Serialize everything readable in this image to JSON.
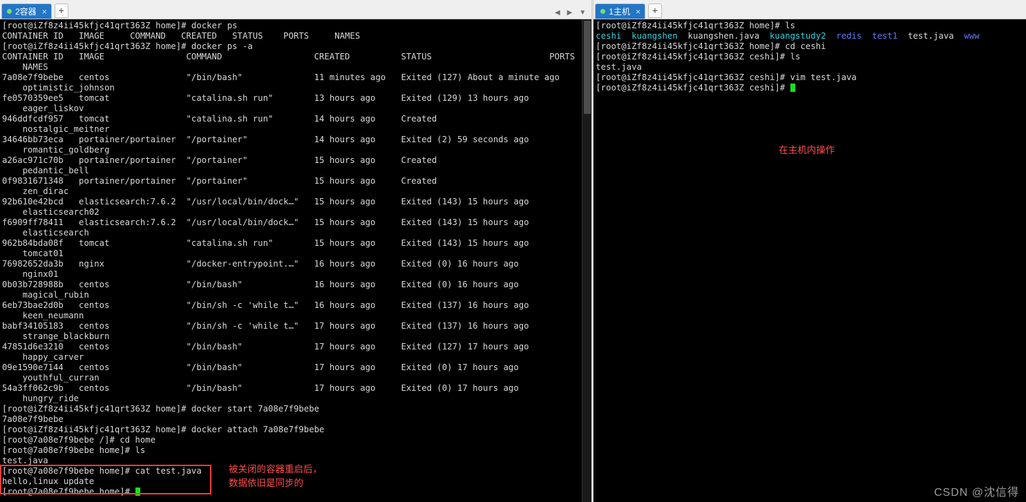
{
  "left_pane": {
    "tab": {
      "label": "2容器",
      "close": "×",
      "status_dot": "green"
    },
    "new_tab": "+",
    "terminal_lines": [
      "[root@iZf8z4ii45kfjc41qrt363Z home]# docker ps",
      "CONTAINER ID   IMAGE     COMMAND   CREATED   STATUS    PORTS     NAMES",
      "[root@iZf8z4ii45kfjc41qrt363Z home]# docker ps -a",
      "CONTAINER ID   IMAGE                COMMAND                  CREATED          STATUS                       PORTS     NAMES",
      "7a08e7f9bebe   centos               \"/bin/bash\"              11 minutes ago   Exited (127) About a minute ago             optimistic_johnson",
      "fe0570359ee5   tomcat               \"catalina.sh run\"        13 hours ago     Exited (129) 13 hours ago                   eager_liskov",
      "946ddfcdf957   tomcat               \"catalina.sh run\"        14 hours ago     Created                                     nostalgic_meitner",
      "34646bb73eca   portainer/portainer  \"/portainer\"             14 hours ago     Exited (2) 59 seconds ago                   romantic_goldberg",
      "a26ac971c70b   portainer/portainer  \"/portainer\"             15 hours ago     Created                                     pedantic_bell",
      "0f9831671348   portainer/portainer  \"/portainer\"             15 hours ago     Created                                     zen_dirac",
      "92b610e42bcd   elasticsearch:7.6.2  \"/usr/local/bin/dock…\"   15 hours ago     Exited (143) 15 hours ago                   elasticsearch02",
      "f6909ff78411   elasticsearch:7.6.2  \"/usr/local/bin/dock…\"   15 hours ago     Exited (143) 15 hours ago                   elasticsearch",
      "962b84bda08f   tomcat               \"catalina.sh run\"        15 hours ago     Exited (143) 15 hours ago                   tomcat01",
      "76982652da3b   nginx                \"/docker-entrypoint.…\"   16 hours ago     Exited (0) 16 hours ago                     nginx01",
      "0b03b728988b   centos               \"/bin/bash\"              16 hours ago     Exited (0) 16 hours ago                     magical_rubin",
      "6eb73bae2d0b   centos               \"/bin/sh -c 'while t…\"   16 hours ago     Exited (137) 16 hours ago                   keen_neumann",
      "babf34105183   centos               \"/bin/sh -c 'while t…\"   17 hours ago     Exited (137) 16 hours ago                   strange_blackburn",
      "47851d6e3210   centos               \"/bin/bash\"              17 hours ago     Exited (127) 17 hours ago                   happy_carver",
      "09e1590e7144   centos               \"/bin/bash\"              17 hours ago     Exited (0) 17 hours ago                     youthful_curran",
      "54a3ff062c9b   centos               \"/bin/bash\"              17 hours ago     Exited (0) 17 hours ago                     hungry_ride",
      "[root@iZf8z4ii45kfjc41qrt363Z home]# docker start 7a08e7f9bebe",
      "7a08e7f9bebe",
      "[root@iZf8z4ii45kfjc41qrt363Z home]# docker attach 7a08e7f9bebe",
      "[root@7a08e7f9bebe /]# cd home",
      "[root@7a08e7f9bebe home]# ls",
      "test.java",
      "[root@7a08e7f9bebe home]# cat test.java",
      "hello,linux update",
      "[root@7a08e7f9bebe home]#"
    ],
    "annotation": "被关闭的容器重启后，\n数据依旧是同步的"
  },
  "right_pane": {
    "tab": {
      "label": "1主机",
      "close": "×",
      "status_dot": "green"
    },
    "new_tab": "+",
    "terminal_lines": [
      "[root@iZf8z4ii45kfjc41qrt363Z home]# ls",
      "ceshi  kuangshen  kuangshen.java  kuangstudy2  redis  test1  test.java  www",
      "[root@iZf8z4ii45kfjc41qrt363Z home]# cd ceshi",
      "[root@iZf8z4ii45kfjc41qrt363Z ceshi]# ls",
      "test.java",
      "[root@iZf8z4ii45kfjc41qrt363Z ceshi]# vim test.java",
      "[root@iZf8z4ii45kfjc41qrt363Z ceshi]#"
    ],
    "ls_items": [
      "ceshi",
      "kuangshen",
      "kuangshen.java",
      "kuangstudy2",
      "redis",
      "test1",
      "test.java",
      "www"
    ],
    "annotation": "在主机内操作"
  },
  "watermark": "CSDN @沈信得",
  "colors": {
    "tab_active": "#2176c7",
    "annotation_red": "#ff4d4d",
    "terminal_bg": "#000000",
    "terminal_fg": "#d8d8d8",
    "dir_blue": "#5c7bfb",
    "cursor_green": "#1be01b"
  }
}
